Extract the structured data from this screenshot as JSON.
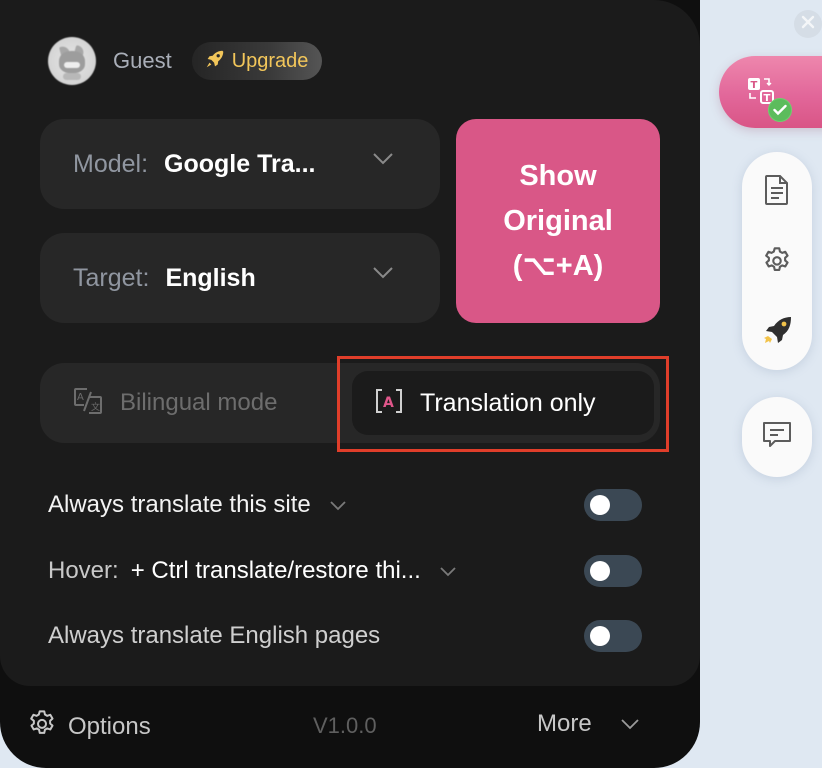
{
  "header": {
    "user_name": "Guest",
    "upgrade_label": "Upgrade",
    "upgrade_icon": "rocket-icon"
  },
  "model_select": {
    "label": "Model:",
    "value": "Google Tra..."
  },
  "target_select": {
    "label": "Target:",
    "value": "English"
  },
  "show_original": {
    "line1": "Show",
    "line2": "Original",
    "line3": "(⌥+A)",
    "color": "#d95787"
  },
  "modes": {
    "bilingual": {
      "label": "Bilingual mode",
      "icon": "bilingual-icon",
      "selected": false
    },
    "translation_only": {
      "label": "Translation only",
      "icon": "translation-only-icon",
      "selected": true
    }
  },
  "highlight_color": "#e03e2a",
  "settings": [
    {
      "label": "Always translate this site",
      "has_dropdown": true,
      "enabled": false
    },
    {
      "label": "Hover:",
      "value": "+ Ctrl translate/restore thi...",
      "has_dropdown": true,
      "enabled": false
    },
    {
      "label": "Always translate English pages",
      "has_dropdown": false,
      "enabled": false
    }
  ],
  "footer": {
    "options_label": "Options",
    "version": "V1.0.0",
    "more_label": "More"
  },
  "side_widgets": {
    "translate_button_icon": "translate-icon",
    "translate_status_icon": "check-icon",
    "tools": [
      "document-icon",
      "gear-icon",
      "rocket-icon"
    ],
    "feedback_icon": "feedback-icon",
    "close_icon": "close-icon"
  }
}
